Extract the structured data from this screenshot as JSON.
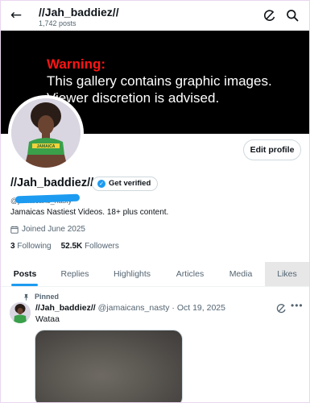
{
  "header": {
    "back_icon": "arrow-left-icon",
    "title": "//Jah_baddiez//",
    "post_count": "1,742 posts",
    "grok_icon": "grok-icon",
    "search_icon": "search-icon"
  },
  "banner": {
    "warning_title": "Warning:",
    "warning_line1": "This gallery contains graphic images.",
    "warning_line2": "Viewer discretion is advised."
  },
  "profile": {
    "edit_profile_label": "Edit profile",
    "name": "//Jah_baddiez//",
    "get_verified_label": "Get verified",
    "handle": "@jamaicans_nasty",
    "bio": "Jamaicas Nastiest Videos. 18+ plus content.",
    "joined": "Joined June 2025",
    "following_count": "3",
    "following_label": "Following",
    "followers_count": "52.5K",
    "followers_label": "Followers",
    "avatar_shirt_text": "JAMAICA"
  },
  "tabs": [
    {
      "label": "Posts",
      "active": true
    },
    {
      "label": "Replies",
      "active": false
    },
    {
      "label": "Highlights",
      "active": false
    },
    {
      "label": "Articles",
      "active": false
    },
    {
      "label": "Media",
      "active": false
    },
    {
      "label": "Likes",
      "active": false
    }
  ],
  "post": {
    "pinned_label": "Pinned",
    "author_name": "//Jah_baddiez//",
    "author_handle": "@jamaicans_nasty",
    "separator": "·",
    "date": "Oct 19, 2025",
    "text": "Wataa",
    "more_icon": "more-horizontal-icon"
  },
  "colors": {
    "accent": "#1d9bf0",
    "warning_red": "#ff1414",
    "banner_bg": "#000000",
    "secondary_text": "#536471"
  }
}
